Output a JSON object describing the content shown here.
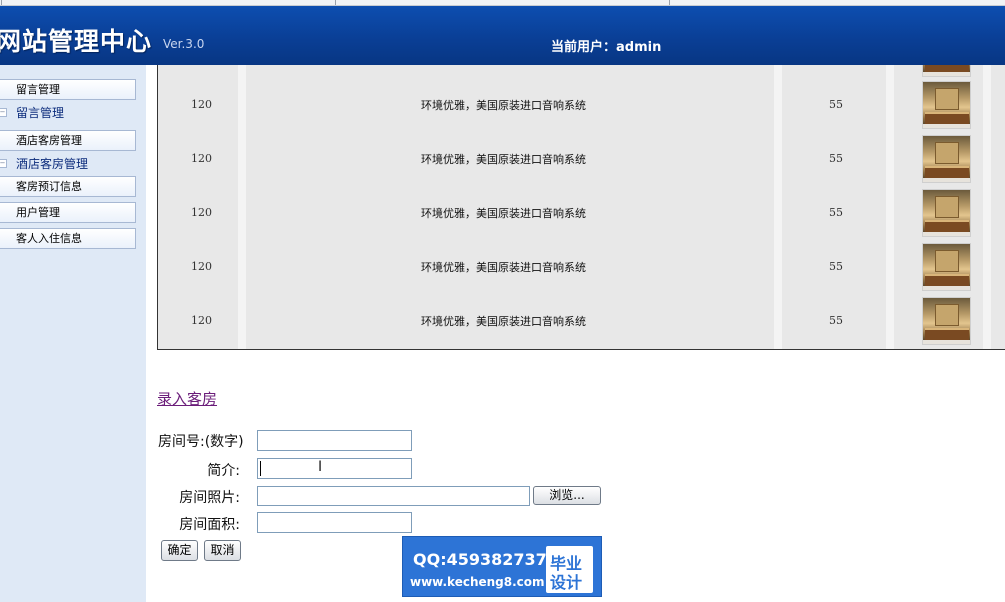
{
  "header": {
    "title": "网站管理中心",
    "version": "Ver.3.0",
    "current_user_label": "当前用户：",
    "current_user": "admin"
  },
  "sidebar": {
    "items": [
      {
        "label": "留言管理",
        "type": "button"
      },
      {
        "label": "留言管理",
        "type": "group"
      },
      {
        "label": "酒店客房管理",
        "type": "button"
      },
      {
        "label": "酒店客房管理",
        "type": "group"
      },
      {
        "label": "客房预订信息",
        "type": "button"
      },
      {
        "label": "用户管理",
        "type": "button"
      },
      {
        "label": "客人入住信息",
        "type": "button"
      }
    ]
  },
  "rooms": {
    "rows": [
      {
        "size": "120",
        "description": "环境优雅，美国原装进口音响系统",
        "price": "55"
      },
      {
        "size": "120",
        "description": "环境优雅，美国原装进口音响系统",
        "price": "55"
      },
      {
        "size": "120",
        "description": "环境优雅，美国原装进口音响系统",
        "price": "55"
      },
      {
        "size": "120",
        "description": "环境优雅，美国原装进口音响系统",
        "price": "55"
      },
      {
        "size": "120",
        "description": "环境优雅，美国原装进口音响系统",
        "price": "55"
      }
    ]
  },
  "form": {
    "add_link": "录入客房",
    "room_number_label": "房间号:(数字)",
    "intro_label": "简介:",
    "photo_label": "房间照片:",
    "area_label": "房间面积:",
    "room_number_value": "",
    "intro_value": "",
    "photo_value": "",
    "area_value": "",
    "browse_label": "浏览...",
    "submit_label": "确定",
    "cancel_label": "取消"
  },
  "watermark": {
    "qq": "QQ:459382737",
    "url": "www.kecheng8.com",
    "badge_line1": "毕业",
    "badge_line2": "设计"
  }
}
